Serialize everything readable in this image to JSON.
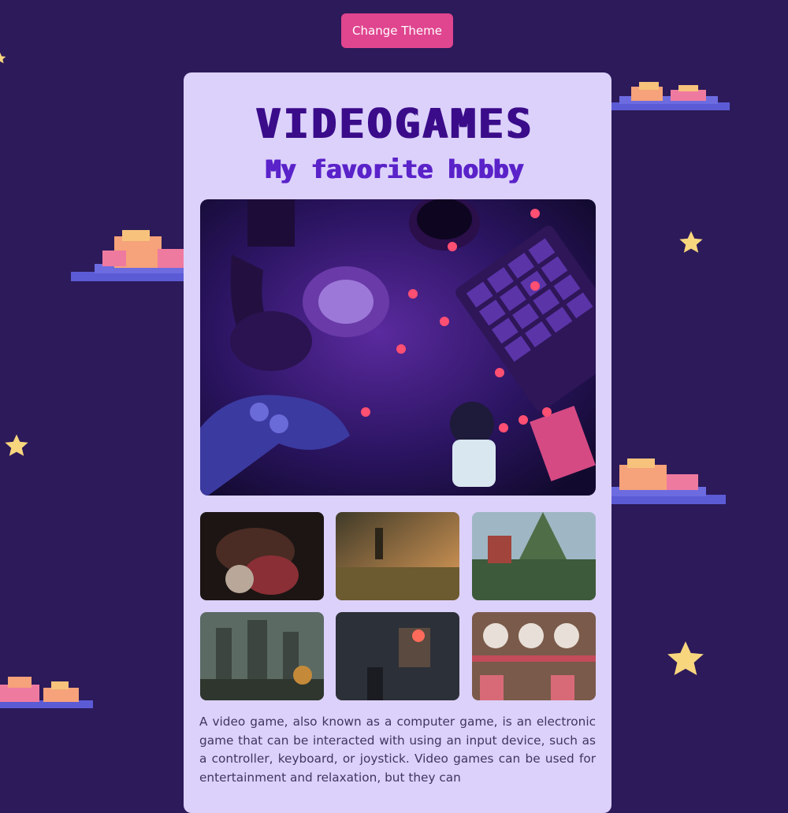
{
  "header": {
    "theme_button_label": "Change Theme"
  },
  "card": {
    "title": "VIDEOGAMES",
    "subtitle": "My favorite hobby",
    "description": "A video game, also known as a computer game, is an electronic game that can be interacted with using an input device, such as a controller, keyboard, or joystick. Video games can be used for entertainment and relaxation, but they can"
  },
  "icons": {
    "hero": "gaming-desk-photo",
    "gallery": [
      "horror-game-screenshot",
      "jungle-game-screenshot",
      "forest-ruins-screenshot",
      "castle-game-screenshot",
      "action-game-screenshot",
      "puppet-game-screenshot"
    ],
    "decor": [
      "pixel-cloud-icon",
      "star-icon"
    ]
  },
  "colors": {
    "background": "#2c1a5a",
    "card": "#dcd1fb",
    "accent": "#e0458f",
    "title": "#3a0c8a",
    "subtitle": "#5a22c9",
    "star": "#f8d67e"
  }
}
